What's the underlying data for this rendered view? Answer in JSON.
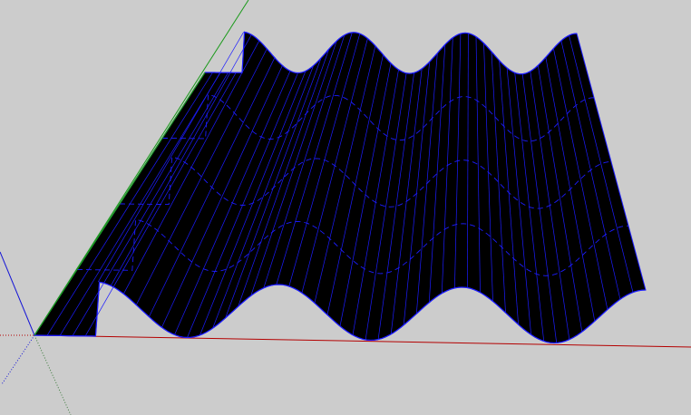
{
  "viewport": {
    "background_color": "#cccccc"
  },
  "axes": {
    "red_axis_color": "#b40000",
    "green_axis_color": "#1a9a1a",
    "blue_axis_color": "#1515d6",
    "dotted_axis_color": "#3a7a3a"
  },
  "model": {
    "name_icon": "corrugated-sheet-model",
    "fill_color": "#000000",
    "edge_color": "#1c1cff",
    "wave_count": 3,
    "section_count": 4
  }
}
